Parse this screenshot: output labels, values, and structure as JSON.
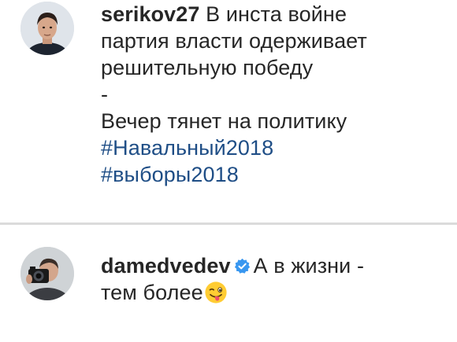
{
  "comments": [
    {
      "username": "serikov27",
      "lines": [
        "В инста войне",
        "партия власти одерживает",
        "решительную победу",
        "-",
        "Вечер тянет на политику"
      ],
      "hashtags": [
        "#Навальный2018",
        "#выборы2018"
      ]
    },
    {
      "username": "damedvedev",
      "verified": true,
      "lines": [
        "А в жизни -",
        "тем более"
      ],
      "emoji": "winking-face-with-tongue"
    }
  ],
  "colors": {
    "text": "#262626",
    "hashtag": "#1f4e86",
    "verified_badge": "#3897f0",
    "divider": "#dbdbdb"
  }
}
